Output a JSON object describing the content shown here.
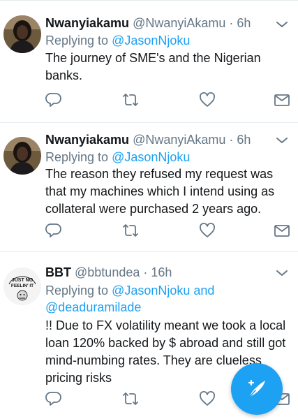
{
  "tweets": [
    {
      "display_name": "Nwanyiakamu",
      "handle": "@NwanyiAkamu",
      "separator": "·",
      "time": "6h",
      "replying_prefix": "Replying to",
      "mentions_line1": "@JasonNjoku",
      "text_lines": [
        "The journey of SME's and the Nigerian",
        "banks."
      ]
    },
    {
      "display_name": "Nwanyiakamu",
      "handle": "@NwanyiAkamu",
      "separator": "·",
      "time": "6h",
      "replying_prefix": "Replying to",
      "mentions_line1": "@JasonNjoku",
      "text_lines": [
        "The reason they refused my request was",
        "that my machines which I intend using as",
        "collateral were purchased 2 years ago."
      ]
    },
    {
      "display_name": "BBT",
      "handle": "@bbtundea",
      "separator": "·",
      "time": "16h",
      "replying_prefix": "Replying to",
      "mentions_line1": "@JasonNjoku and",
      "mentions_line2": "@deaduramilade",
      "text_lines": [
        "!! Due to FX volatility meant we took a local",
        "loan 120% backed by $ abroad and still got",
        "mind-numbing rates. They are clueless",
        "pricing risks"
      ],
      "avatar_text": [
        "JUST NO",
        "FEELIN' IT"
      ]
    }
  ],
  "icons": {
    "reply": "reply-icon",
    "retweet": "retweet-icon",
    "like": "heart-icon",
    "dm": "envelope-icon",
    "more": "chevron-down-icon",
    "compose": "compose-tweet-icon"
  },
  "colors": {
    "accent": "#1da1f2",
    "secondary_text": "#657786",
    "primary_text": "#14171a",
    "divider": "#e6ecf0"
  }
}
